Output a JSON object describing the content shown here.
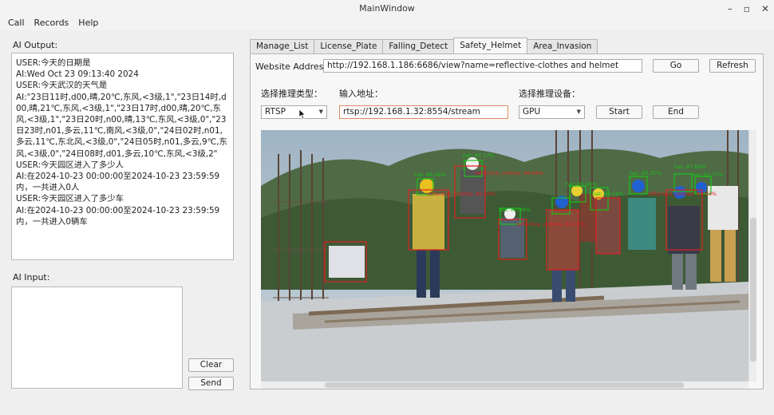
{
  "window": {
    "title": "MainWindow"
  },
  "menu": [
    "Call",
    "Records",
    "Help"
  ],
  "left": {
    "output_label": "AI Output:",
    "output_lines": [
      "USER:今天的日期是",
      "AI:Wed Oct 23 09:13:40 2024",
      "USER:今天武汉的天气是",
      "AI:\"23日11时,d00,晴,20℃,东风,<3级,1\",\"23日14时,d00,晴,21℃,东风,<3级,1\",\"23日17时,d00,晴,20℃,东风,<3级,1\",\"23日20时,n00,晴,13℃,东风,<3级,0\",\"23日23时,n01,多云,11℃,南风,<3级,0\",\"24日02时,n01,多云,11℃,东北风,<3级,0\",\"24日05时,n01,多云,9℃,东风,<3级,0\",\"24日08时,d01,多云,10℃,东风,<3级,2\"",
      "USER:今天园区进入了多少人",
      "AI:在2024-10-23 00:00:00至2024-10-23 23:59:59内，一共进入0人",
      "USER:今天园区进入了多少车",
      "AI:在2024-10-23 00:00:00至2024-10-23 23:59:59内，一共进入0辆车"
    ],
    "input_label": "AI Input:",
    "clear_label": "Clear",
    "send_label": "Send"
  },
  "tabs": [
    "Manage_List",
    "License_Plate",
    "Falling_Detect",
    "Safety_Helmet",
    "Area_Invasion"
  ],
  "active_tab": "Safety_Helmet",
  "web": {
    "address_label": "Website Address:",
    "address": "http://192.168.1.186:6686/view?name=reflective-clothes and helmet",
    "go_label": "Go",
    "refresh_label": "Refresh"
  },
  "infer": {
    "type_label": "选择推理类型：",
    "type_value": "RTSP",
    "addr_label": "输入地址：",
    "addr_value": "rtsp://192.168.1.32:8554/stream",
    "device_label": "选择推理设备：",
    "device_value": "GPU",
    "start_label": "Start",
    "end_label": "End"
  },
  "detections": [
    {
      "label": "hat: 87.17%",
      "color": "#19c219"
    },
    {
      "label": "hat: 88.88%",
      "color": "#19c219"
    },
    {
      "label": "hat: 86.58%",
      "color": "#19c219"
    },
    {
      "label": "hat: 87.66%",
      "color": "#19c219"
    },
    {
      "label": "hat: 89.31%",
      "color": "#19c219"
    },
    {
      "label": "hat: 80.09%",
      "color": "#19c219"
    },
    {
      "label": "hat: 85.90%",
      "color": "#19c219"
    },
    {
      "label": "hat: 83.17%",
      "color": "#19c219"
    },
    {
      "label": "reflective_clothes: 86.68%",
      "color": "#e02020"
    },
    {
      "label": "reflective_clothes: 80.10%",
      "color": "#e02020"
    },
    {
      "label": "reflective_clothes: 84.22%",
      "color": "#e02020"
    },
    {
      "label": "reflective_clothes: 80.03%",
      "color": "#e02020"
    }
  ]
}
